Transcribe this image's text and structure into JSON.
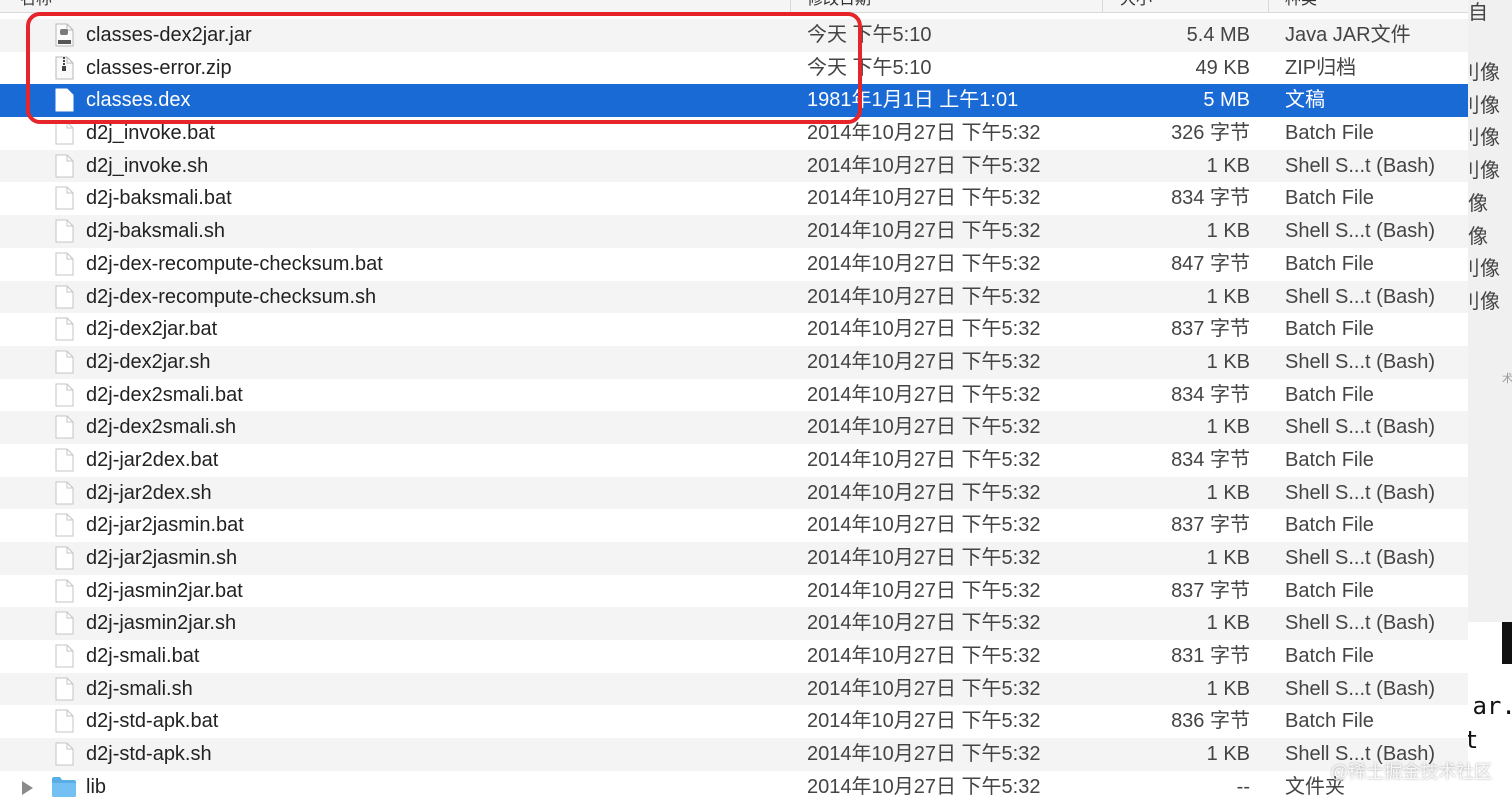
{
  "header": {
    "name_label": "名称",
    "date_label": "修改日期",
    "size_label": "大小",
    "kind_label": "种类"
  },
  "files": [
    {
      "name": "classes-dex2jar.jar",
      "date": "今天 下午5:10",
      "size": "5.4 MB",
      "kind": "Java JAR文件",
      "icon": "jar-file-icon"
    },
    {
      "name": "classes-error.zip",
      "date": "今天 下午5:10",
      "size": "49 KB",
      "kind": "ZIP归档",
      "icon": "zip-file-icon"
    },
    {
      "name": "classes.dex",
      "date": "1981年1月1日 上午1:01",
      "size": "5 MB",
      "kind": "文稿",
      "icon": "document-icon",
      "selected": true
    },
    {
      "name": "d2j_invoke.bat",
      "date": "2014年10月27日 下午5:32",
      "size": "326 字节",
      "kind": "Batch File",
      "icon": "document-icon"
    },
    {
      "name": "d2j_invoke.sh",
      "date": "2014年10月27日 下午5:32",
      "size": "1 KB",
      "kind": "Shell S...t (Bash)",
      "icon": "document-icon"
    },
    {
      "name": "d2j-baksmali.bat",
      "date": "2014年10月27日 下午5:32",
      "size": "834 字节",
      "kind": "Batch File",
      "icon": "document-icon"
    },
    {
      "name": "d2j-baksmali.sh",
      "date": "2014年10月27日 下午5:32",
      "size": "1 KB",
      "kind": "Shell S...t (Bash)",
      "icon": "document-icon"
    },
    {
      "name": "d2j-dex-recompute-checksum.bat",
      "date": "2014年10月27日 下午5:32",
      "size": "847 字节",
      "kind": "Batch File",
      "icon": "document-icon"
    },
    {
      "name": "d2j-dex-recompute-checksum.sh",
      "date": "2014年10月27日 下午5:32",
      "size": "1 KB",
      "kind": "Shell S...t (Bash)",
      "icon": "document-icon"
    },
    {
      "name": "d2j-dex2jar.bat",
      "date": "2014年10月27日 下午5:32",
      "size": "837 字节",
      "kind": "Batch File",
      "icon": "document-icon"
    },
    {
      "name": "d2j-dex2jar.sh",
      "date": "2014年10月27日 下午5:32",
      "size": "1 KB",
      "kind": "Shell S...t (Bash)",
      "icon": "document-icon"
    },
    {
      "name": "d2j-dex2smali.bat",
      "date": "2014年10月27日 下午5:32",
      "size": "834 字节",
      "kind": "Batch File",
      "icon": "document-icon"
    },
    {
      "name": "d2j-dex2smali.sh",
      "date": "2014年10月27日 下午5:32",
      "size": "1 KB",
      "kind": "Shell S...t (Bash)",
      "icon": "document-icon"
    },
    {
      "name": "d2j-jar2dex.bat",
      "date": "2014年10月27日 下午5:32",
      "size": "834 字节",
      "kind": "Batch File",
      "icon": "document-icon"
    },
    {
      "name": "d2j-jar2dex.sh",
      "date": "2014年10月27日 下午5:32",
      "size": "1 KB",
      "kind": "Shell S...t (Bash)",
      "icon": "document-icon"
    },
    {
      "name": "d2j-jar2jasmin.bat",
      "date": "2014年10月27日 下午5:32",
      "size": "837 字节",
      "kind": "Batch File",
      "icon": "document-icon"
    },
    {
      "name": "d2j-jar2jasmin.sh",
      "date": "2014年10月27日 下午5:32",
      "size": "1 KB",
      "kind": "Shell S...t (Bash)",
      "icon": "document-icon"
    },
    {
      "name": "d2j-jasmin2jar.bat",
      "date": "2014年10月27日 下午5:32",
      "size": "837 字节",
      "kind": "Batch File",
      "icon": "document-icon"
    },
    {
      "name": "d2j-jasmin2jar.sh",
      "date": "2014年10月27日 下午5:32",
      "size": "1 KB",
      "kind": "Shell S...t (Bash)",
      "icon": "document-icon"
    },
    {
      "name": "d2j-smali.bat",
      "date": "2014年10月27日 下午5:32",
      "size": "831 字节",
      "kind": "Batch File",
      "icon": "document-icon"
    },
    {
      "name": "d2j-smali.sh",
      "date": "2014年10月27日 下午5:32",
      "size": "1 KB",
      "kind": "Shell S...t (Bash)",
      "icon": "document-icon"
    },
    {
      "name": "d2j-std-apk.bat",
      "date": "2014年10月27日 下午5:32",
      "size": "836 字节",
      "kind": "Batch File",
      "icon": "document-icon"
    },
    {
      "name": "d2j-std-apk.sh",
      "date": "2014年10月27日 下午5:32",
      "size": "1 KB",
      "kind": "Shell S...t (Bash)",
      "icon": "document-icon"
    },
    {
      "name": "lib",
      "date": "2014年10月27日 下午5:32",
      "size": "--",
      "kind": "文件夹",
      "icon": "folder-icon",
      "folder": true
    }
  ],
  "right_peek": {
    "top_char": "自",
    "items": [
      "刂像",
      "刂像",
      "刂像",
      "刂像",
      "像",
      "像",
      "刂像",
      "刂像"
    ],
    "small_char": "术"
  },
  "terminal": {
    "line1": "jar.s",
    "line2": "t"
  },
  "watermark": "@稀土掘金技术社区",
  "colors": {
    "selection": "#1a6ad5",
    "highlight_box": "#e5252a",
    "folder": "#5aaee8"
  }
}
